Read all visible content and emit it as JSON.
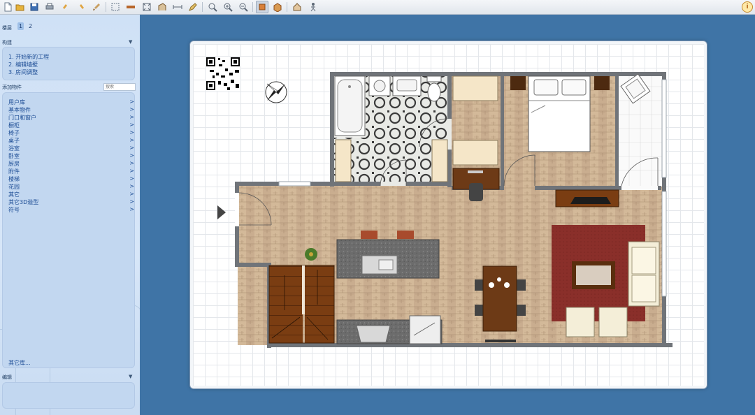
{
  "toolbar": {
    "icons": [
      "new-document-icon",
      "open-folder-icon",
      "save-icon",
      "print-icon",
      "undo-icon",
      "redo-icon",
      "brush-icon",
      "select-icon",
      "wall-icon",
      "room-icon",
      "door-tool-icon",
      "dimension-icon",
      "pencil-icon",
      "zoom-fit-icon",
      "zoom-in-icon",
      "zoom-out-icon",
      "2d-view-icon",
      "3d-view-icon",
      "house-view-icon",
      "walk-icon"
    ],
    "info_label": "i"
  },
  "sidebar": {
    "floors_label": "楼层",
    "floors": [
      "1",
      "2"
    ],
    "selected_floor": "1",
    "construct_title": "构建",
    "construct_items": [
      "1. 开始新的工程",
      "2. 编辑墙壁",
      "3. 房间调整"
    ],
    "add_title": "添加物件",
    "search_placeholder": "搜索",
    "library_items": [
      "用户库",
      "基本物件",
      "门口和窗户",
      "橱柜",
      "椅子",
      "桌子",
      "浴室",
      "卧室",
      "厨房",
      "附件",
      "楼梯",
      "花园",
      "其它",
      "其它3D造型",
      "符号"
    ],
    "more_library": "其它库...",
    "edit_title": "编辑",
    "arrow": ">",
    "chevron": "▼"
  },
  "colors": {
    "background": "#3f74a6",
    "wall": "#6b6f74",
    "floor_wood": "#c8ad8f",
    "rug": "#8a2f2a",
    "counter": "#6e6e6e",
    "stairs": "#7a3d12"
  }
}
